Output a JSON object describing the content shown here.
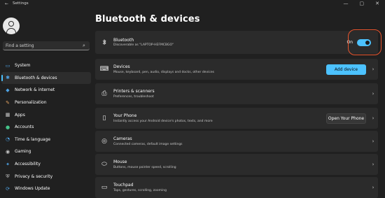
{
  "window": {
    "title": "Settings",
    "controls": [
      "—",
      "▢",
      "✕"
    ]
  },
  "sidebar": {
    "search_placeholder": "Find a setting",
    "items": [
      {
        "label": "System",
        "icon": "system-icon",
        "color": "#4ea3e5"
      },
      {
        "label": "Bluetooth & devices",
        "icon": "bluetooth-icon",
        "color": "#4ea3e5",
        "active": true
      },
      {
        "label": "Network & internet",
        "icon": "wifi-icon",
        "color": "#4ea3e5"
      },
      {
        "label": "Personalization",
        "icon": "brush-icon",
        "color": "#e0a060"
      },
      {
        "label": "Apps",
        "icon": "apps-icon",
        "color": "#c9c9c9"
      },
      {
        "label": "Accounts",
        "icon": "accounts-icon",
        "color": "#45c48a"
      },
      {
        "label": "Time & language",
        "icon": "globe-clock-icon",
        "color": "#4ea3e5"
      },
      {
        "label": "Gaming",
        "icon": "gamepad-icon",
        "color": "#c9c9c9"
      },
      {
        "label": "Accessibility",
        "icon": "accessibility-icon",
        "color": "#4ea3e5"
      },
      {
        "label": "Privacy & security",
        "icon": "shield-icon",
        "color": "#c9c9c9"
      },
      {
        "label": "Windows Update",
        "icon": "update-icon",
        "color": "#4ea3e5"
      }
    ]
  },
  "main": {
    "title": "Bluetooth & devices",
    "bluetooth": {
      "title": "Bluetooth",
      "subtitle": "Discoverable as \"LAPTOP-HEFMCBGO\"",
      "toggle_label": "On",
      "toggle_on": true
    },
    "cards": [
      {
        "title": "Devices",
        "subtitle": "Mouse, keyboard, pen, audio, displays and docks, other devices",
        "icon": "devices-icon",
        "button": "Add device",
        "button_style": "accent"
      },
      {
        "title": "Printers & scanners",
        "subtitle": "Preferences, troubleshoot",
        "icon": "printer-icon"
      },
      {
        "title": "Your Phone",
        "subtitle": "Instantly access your Android device's photos, texts, and more",
        "icon": "phone-icon",
        "button": "Open Your Phone",
        "button_style": "normal"
      },
      {
        "title": "Cameras",
        "subtitle": "Connected cameras, default image settings",
        "icon": "camera-icon"
      },
      {
        "title": "Mouse",
        "subtitle": "Buttons, mouse pointer speed, scrolling",
        "icon": "mouse-icon"
      },
      {
        "title": "Touchpad",
        "subtitle": "Taps, gestures, scrolling, zooming",
        "icon": "touchpad-icon"
      }
    ]
  },
  "colors": {
    "accent": "#4cc2ff",
    "highlight": "#e8552e",
    "background": "#202020",
    "card": "#2b2b2b"
  }
}
